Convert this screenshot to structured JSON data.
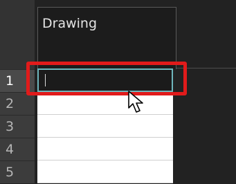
{
  "column": {
    "title": "Drawing"
  },
  "rows": [
    {
      "number": "1",
      "value": ""
    },
    {
      "number": "2",
      "value": ""
    },
    {
      "number": "3",
      "value": ""
    },
    {
      "number": "4",
      "value": ""
    },
    {
      "number": "5",
      "value": ""
    }
  ],
  "active_row": "1",
  "colors": {
    "highlight": "#e11b1b",
    "edit_border": "#6fb7bd"
  },
  "cursor": "arrow-pointer-icon"
}
